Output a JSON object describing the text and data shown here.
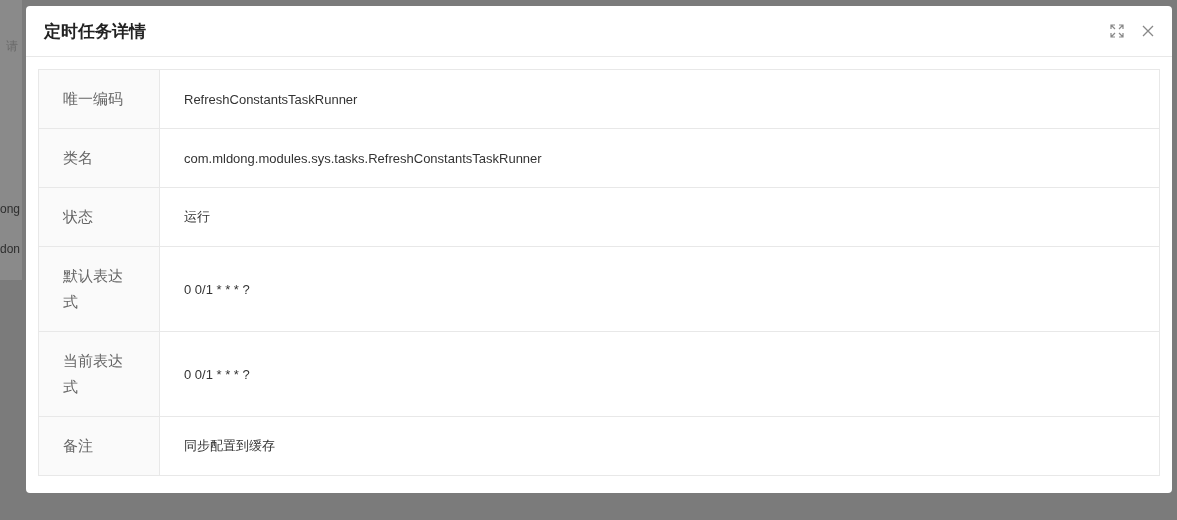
{
  "background_page": {
    "fragments": [
      "请",
      "ong",
      "don"
    ]
  },
  "dialog": {
    "title": "定时任务详情",
    "fields": [
      {
        "label": "唯一编码",
        "value": "RefreshConstantsTaskRunner"
      },
      {
        "label": "类名",
        "value": "com.mldong.modules.sys.tasks.RefreshConstantsTaskRunner"
      },
      {
        "label": "状态",
        "value": "运行"
      },
      {
        "label": "默认表达式",
        "value": "0 0/1 * * * ?"
      },
      {
        "label": "当前表达式",
        "value": "0 0/1 * * * ?"
      },
      {
        "label": "备注",
        "value": "同步配置到缓存"
      }
    ]
  }
}
